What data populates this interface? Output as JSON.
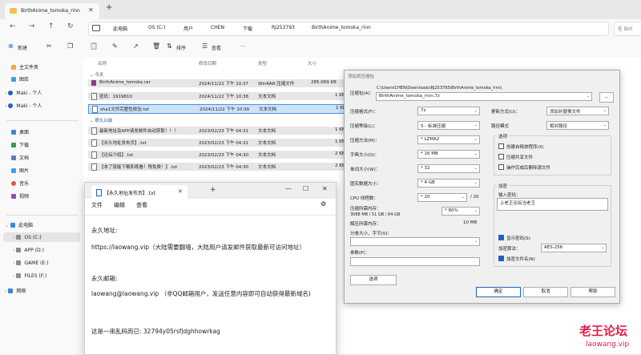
{
  "explorer": {
    "tab_title": "BirthAnime_tomoka_rinn",
    "tab_close": "✕",
    "new_tab": "+",
    "crumbs": [
      "此电脑",
      "OS (C:)",
      "用户",
      "CHEN",
      "下载",
      "RJ253793",
      "BirthAnime_tomoka_rinn"
    ],
    "search_placeholder": "在 Birt",
    "toolbar": {
      "new": "新建",
      "sort": "排序",
      "view": "查看"
    },
    "sidebar": {
      "home": "主文件夹",
      "gallery": "图库",
      "maki1": "Maki - 个人",
      "maki2": "Maki - 个人",
      "desktop": "桌面",
      "downloads": "下载",
      "documents": "文档",
      "pictures": "图片",
      "music": "音乐",
      "videos": "视频",
      "thispc": "此电脑",
      "c": "OS (C:)",
      "d": "APP (D:)",
      "e": "GAME (E:)",
      "f": "FILES (F:)",
      "network": "网络"
    },
    "columns": {
      "name": "名称",
      "date": "修改日期",
      "type": "类型",
      "size": "大小"
    },
    "groups": {
      "today": "今天",
      "earlier": "很久以前"
    },
    "files_today": [
      {
        "name": "BirthAnime_tomoka.rar",
        "date": "2024/11/22 下午 10:37",
        "type": "WinRAR 压缩文件",
        "size": "285,069 KB"
      },
      {
        "name": "密码：1919810",
        "date": "2024/11/22 下午 10:38",
        "type": "文本文档",
        "size": "1 KB"
      },
      {
        "name": "sha1文件完整性校验.txt",
        "date": "2024/11/22 下午 10:39",
        "type": "文本文档",
        "size": "1 KB"
      }
    ],
    "files_old": [
      {
        "name": "最新地址及APP请发邮件自动获取！！！",
        "date": "2023/02/23 下午 04:31",
        "type": "文本文档",
        "size": "1 KB"
      },
      {
        "name": "【永久地址发布页】.txt",
        "date": "2023/02/23 下午 04:31",
        "type": "文本文档",
        "size": "1 KB"
      },
      {
        "name": "【论坛介绍】.txt",
        "date": "2023/02/23 下午 04:30",
        "type": "文本文档",
        "size": "2 KB"
      },
      {
        "name": "【本了就能下载和观看！残免费！】.txt",
        "date": "2023/02/23 下午 04:30",
        "type": "文本文档",
        "size": "2 KB"
      }
    ]
  },
  "dialog": {
    "title": "添加到压缩包",
    "archive_label": "压缩包(A)：",
    "archive_path": "C:\\Users\\CHEN\\Downloads\\RJ253793\\BirthAnime_tomoka_rinn\\",
    "archive_name": "BirthAnime_tomoka_rinn.7z",
    "browse": "...",
    "format_label": "压缩格式(F)：",
    "format": "7z",
    "level_label": "压缩等级(L)：",
    "level": "5 - 标准压缩",
    "method_label": "压缩方法(M)：",
    "method": "* LZMA2",
    "dict_label": "字典大小(D)：",
    "dict": "* 16 MB",
    "word_label": "单词大小(W)：",
    "word": "* 32",
    "solid_label": "固实数据大小：",
    "solid": "* 4 GB",
    "cpu_label": "CPU 线程数：",
    "cpu": "* 20",
    "cpu_max": "/ 20",
    "mem_label": "压缩所需内存：",
    "mem_info": "3088 MB / 51 GB / 64 GB",
    "mem_pct": "* 80%",
    "dmem_label": "解压所需内存：",
    "dmem": "10 MB",
    "split_label": "分卷大小，字节(V)：",
    "params_label": "参数(P)：",
    "options_btn": "选项",
    "update_label": "更新方式(U)：",
    "update": "添加并替换文件",
    "pathmode_label": "路径模式",
    "pathmode": "相对路径",
    "options_group": "选项",
    "opt_sfx": "创建自释放程序(X)",
    "opt_shared": "压缩共享文件",
    "opt_delete": "操作完成后删除源文件",
    "encrypt_group": "加密",
    "pwd_label": "输入密码：",
    "pwd": "上老王论坛当老王",
    "show_pwd": "显示密码(S)",
    "enc_method_label": "加密算法：",
    "enc_method": "AES-256",
    "enc_names": "加密文件名(N)",
    "ok": "确定",
    "cancel": "取消",
    "help": "帮助"
  },
  "notepad": {
    "tab_title": "【永久地址发布页】.txt",
    "tab_close": "✕",
    "new_tab": "+",
    "menu": {
      "file": "文件",
      "edit": "编辑",
      "view": "查看"
    },
    "lines": [
      "永久地址:",
      "https://laowang.vip（大陆需要翻墙，大陆用户请发邮件获取最新可访问地址）",
      "永久邮箱:",
      "laowang@laowang.vip （非QQ邮箱用户，发送任意内容即可自动获得最新域名)",
      "这是一串乱码而已: 32794y05rsfjdghhowrkag"
    ]
  },
  "watermark": {
    "name": "老王论坛",
    "url": "laowang.vip"
  },
  "colors": {
    "accent": "#1e63c4",
    "watermark": "#e11d48",
    "selection": "#cde3f7"
  }
}
